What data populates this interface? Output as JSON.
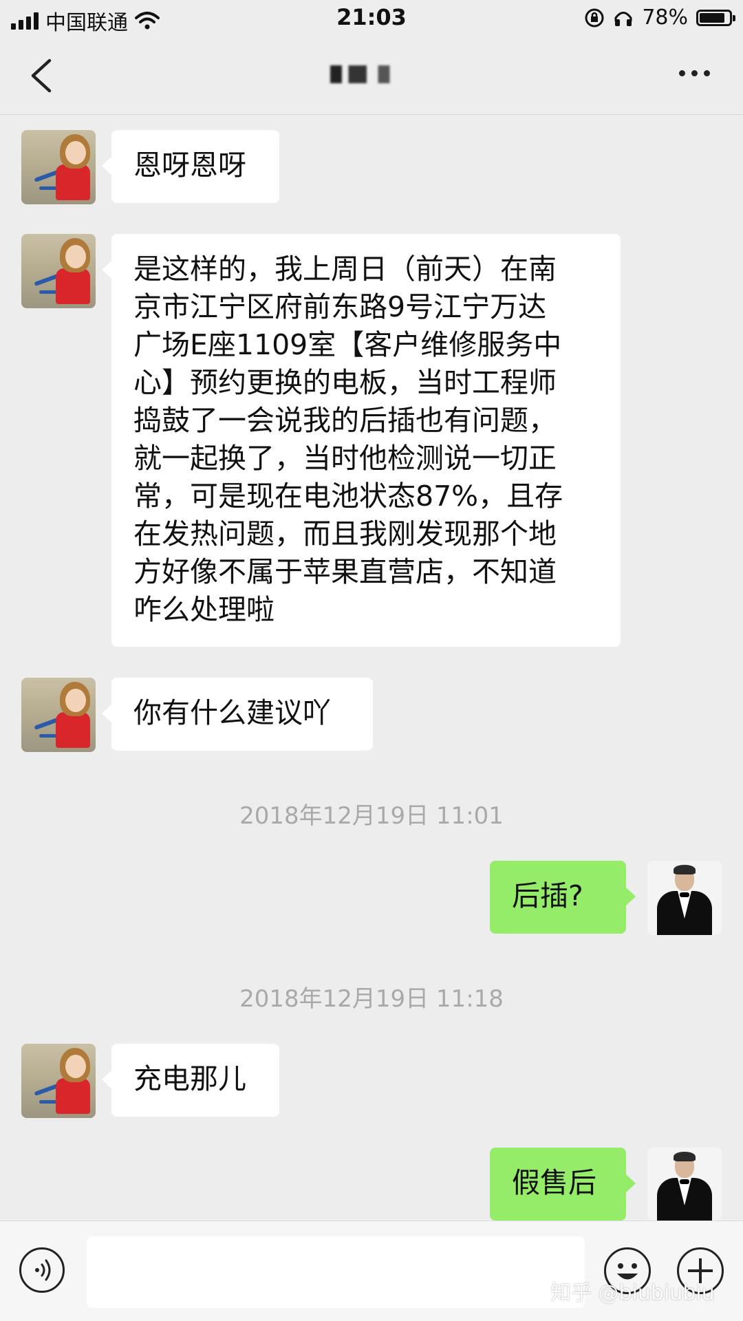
{
  "status_bar": {
    "carrier": "中国联通",
    "time": "21:03",
    "battery_text": "78%",
    "battery_level": 0.78
  },
  "nav": {
    "back_icon": "chevron-left-icon",
    "more_icon": "more-dots-icon"
  },
  "messages": [
    {
      "side": "in",
      "avatar": "child-avatar",
      "text": "恩呀恩呀"
    },
    {
      "side": "in",
      "avatar": "child-avatar",
      "text": "是这样的，我上周日（前天）在南\n京市江宁区府前东路9号江宁万达\n广场E座1109室【客户维修服务中\n心】预约更换的电板，当时工程师\n捣鼓了一会说我的后插也有问题，\n就一起换了，当时他检测说一切正\n常，可是现在电池状态87%，且存\n在发热问题，而且我刚发现那个地\n方好像不属于苹果直营店，不知道\n咋么处理啦"
    },
    {
      "side": "in",
      "avatar": "child-avatar",
      "text": "你有什么建议吖"
    },
    {
      "type": "timestamp",
      "text": "2018年12月19日 11:01"
    },
    {
      "side": "out",
      "avatar": "man-avatar",
      "text": "后插?"
    },
    {
      "type": "timestamp",
      "text": "2018年12月19日 11:18"
    },
    {
      "side": "in",
      "avatar": "child-avatar",
      "text": "充电那儿"
    },
    {
      "side": "out",
      "avatar": "man-avatar",
      "text": "假售后"
    }
  ],
  "input_bar": {
    "voice_icon": "voice-icon",
    "text_value": "",
    "emoji_icon": "emoji-icon",
    "plus_icon": "plus-icon"
  },
  "watermark": "知乎 @biubiubiu",
  "colors": {
    "background": "#ededed",
    "incoming_bubble": "#ffffff",
    "outgoing_bubble": "#95ec69",
    "timestamp": "#a9a9a9"
  }
}
